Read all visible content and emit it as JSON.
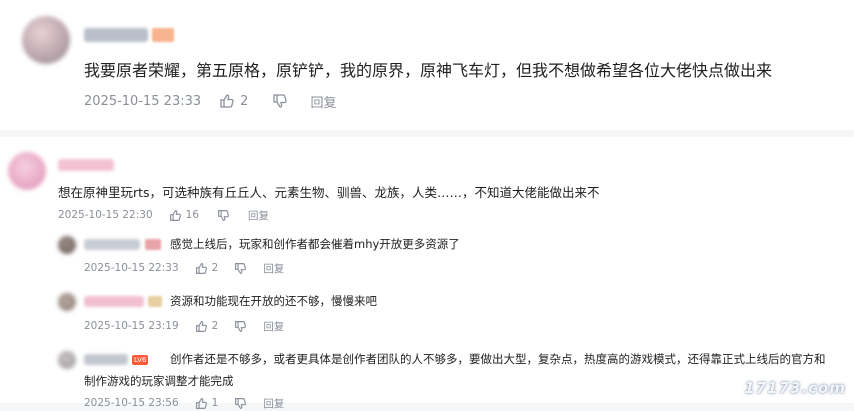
{
  "top_comment": {
    "text": "我要原者荣耀，第五原格，原铲铲，我的原界，原神飞车灯，但我不想做希望各位大佬快点做出来",
    "time": "2025-10-15 23:33",
    "likes": "2",
    "reply_label": "回复"
  },
  "main_comment": {
    "text": "想在原神里玩rts，可选种族有丘丘人、元素生物、驯兽、龙族，人类……，不知道大佬能做出来不",
    "time": "2025-10-15 22:30",
    "likes": "16",
    "reply_label": "回复"
  },
  "replies": [
    {
      "text": "感觉上线后，玩家和创作者都会催着mhy开放更多资源了",
      "time": "2025-10-15 22:33",
      "likes": "2",
      "reply_label": "回复"
    },
    {
      "text": "资源和功能现在开放的还不够，慢慢来吧",
      "time": "2025-10-15 23:19",
      "likes": "2",
      "reply_label": "回复"
    },
    {
      "text_line1": "创作者还是不够多，或者更具体是创作者团队的人不够多，要做出大型，复杂点，热度高的游戏模式，还得靠正式上线后的官方和",
      "text_line2": "制作游戏的玩家调整才能完成",
      "badge": "LV6",
      "time": "2025-10-15 23:56",
      "likes": "1",
      "reply_label": "回复"
    }
  ],
  "watermark": "17173.com",
  "colors": {
    "meta": "#8a8f99",
    "accent_badge": "#ff5a36",
    "background": "#f5f6f8"
  },
  "icons": {
    "like": "thumbs-up-icon",
    "dislike": "thumbs-down-icon"
  }
}
